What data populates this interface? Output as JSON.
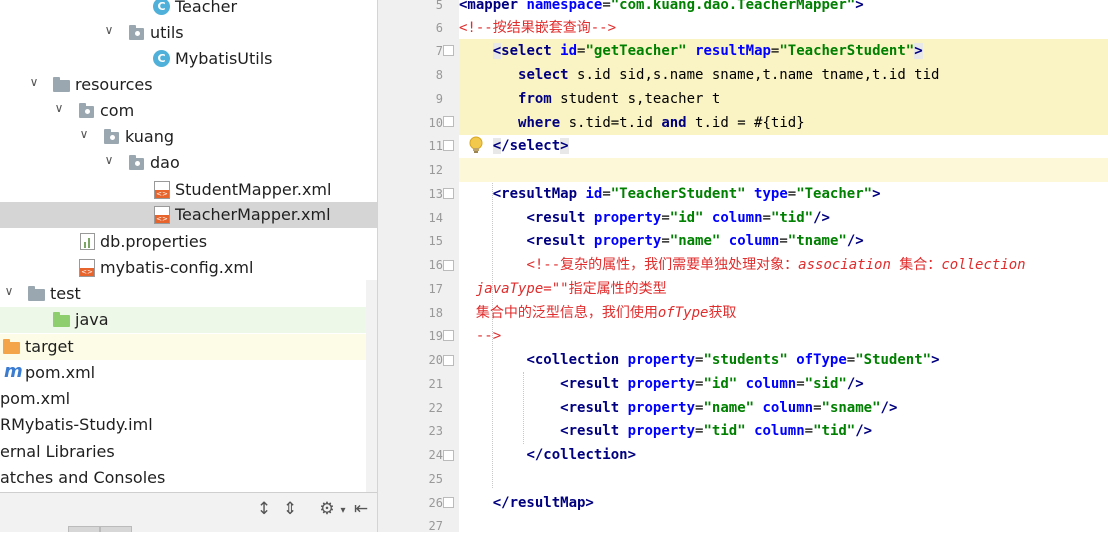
{
  "tree": {
    "items": [
      {
        "label": "Teacher"
      },
      {
        "label": "utils"
      },
      {
        "label": "MybatisUtils"
      },
      {
        "label": "resources"
      },
      {
        "label": "com"
      },
      {
        "label": "kuang"
      },
      {
        "label": "dao"
      },
      {
        "label": "StudentMapper.xml"
      },
      {
        "label": "TeacherMapper.xml"
      },
      {
        "label": "db.properties"
      },
      {
        "label": "mybatis-config.xml"
      },
      {
        "label": "test"
      },
      {
        "label": "java"
      },
      {
        "label": "target"
      },
      {
        "label": "pom.xml"
      },
      {
        "label": "pom.xml"
      },
      {
        "label": "RMybatis-Study.iml"
      },
      {
        "label": "ernal Libraries"
      },
      {
        "label": "atches and Consoles"
      }
    ]
  },
  "editor": {
    "line_numbers": [
      "5",
      "6",
      "7",
      "8",
      "9",
      "10",
      "11",
      "12",
      "13",
      "14",
      "15",
      "16",
      "17",
      "18",
      "19",
      "20",
      "21",
      "22",
      "23",
      "24",
      "25",
      "26",
      "27"
    ]
  },
  "colors": {
    "highlight": "#fcf8d8",
    "tag": "#000080",
    "attr": "#0000ff",
    "value": "#008000",
    "comment": "#e02d2d"
  },
  "icons": {
    "bulb": "lightbulb-icon",
    "expand": "expand-all-icon",
    "collapse": "collapse-all-icon",
    "settings": "gear-icon",
    "hide": "hide-panel-icon"
  }
}
